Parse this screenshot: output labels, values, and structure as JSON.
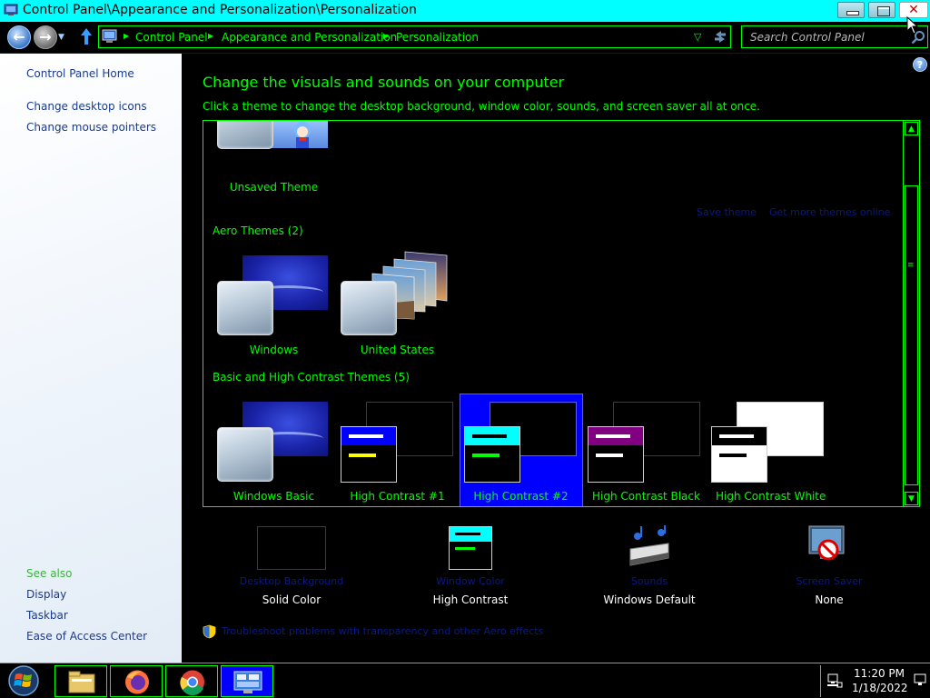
{
  "window": {
    "title": "Control Panel\\Appearance and Personalization\\Personalization",
    "close_glyph": "✕"
  },
  "nav": {
    "back_glyph": "←",
    "forward_glyph": "→",
    "up_glyph": "🡅",
    "breadcrumbs": [
      "Control Panel",
      "Appearance and Personalization",
      "Personalization"
    ],
    "separator_glyph": "▶",
    "search_placeholder": "Search Control Panel"
  },
  "sidebar": {
    "home": "Control Panel Home",
    "tasks": [
      "Change desktop icons",
      "Change mouse pointers"
    ],
    "see_also_heading": "See also",
    "see_also": [
      "Display",
      "Taskbar",
      "Ease of Access Center"
    ]
  },
  "main": {
    "heading": "Change the visuals and sounds on your computer",
    "subheading": "Click a theme to change the desktop background, window color, sounds, and screen saver all at once.",
    "help_glyph": "?",
    "my_themes": {
      "unsaved_label": "Unsaved Theme"
    },
    "save_theme_link": "Save theme",
    "get_more_link": "Get more themes online",
    "aero_heading": "Aero Themes (2)",
    "aero_themes": [
      "Windows",
      "United States"
    ],
    "basic_heading": "Basic and High Contrast Themes (5)",
    "basic_themes": [
      "Windows Basic",
      "High Contrast #1",
      "High Contrast #2",
      "High Contrast Black",
      "High Contrast White"
    ],
    "selected_theme": "High Contrast #2"
  },
  "settings": [
    {
      "link": "Desktop Background",
      "value": "Solid Color",
      "icon": "desktop-background-icon"
    },
    {
      "link": "Window Color",
      "value": "High Contrast",
      "icon": "window-color-icon"
    },
    {
      "link": "Sounds",
      "value": "Windows Default",
      "icon": "sounds-icon"
    },
    {
      "link": "Screen Saver",
      "value": "None",
      "icon": "screen-saver-icon"
    }
  ],
  "troubleshoot_link": "Troubleshoot problems with transparency and other Aero effects",
  "taskbar": {
    "time": "11:20 PM",
    "date": "1/18/2022",
    "pinned": [
      "file-explorer-icon",
      "firefox-icon",
      "chrome-icon",
      "control-panel-icon"
    ]
  },
  "colors": {
    "accent_text": "#00ff00",
    "titlebar": "#00ffff",
    "selection": "#0000ff",
    "link_dark": "#0a1a80"
  }
}
